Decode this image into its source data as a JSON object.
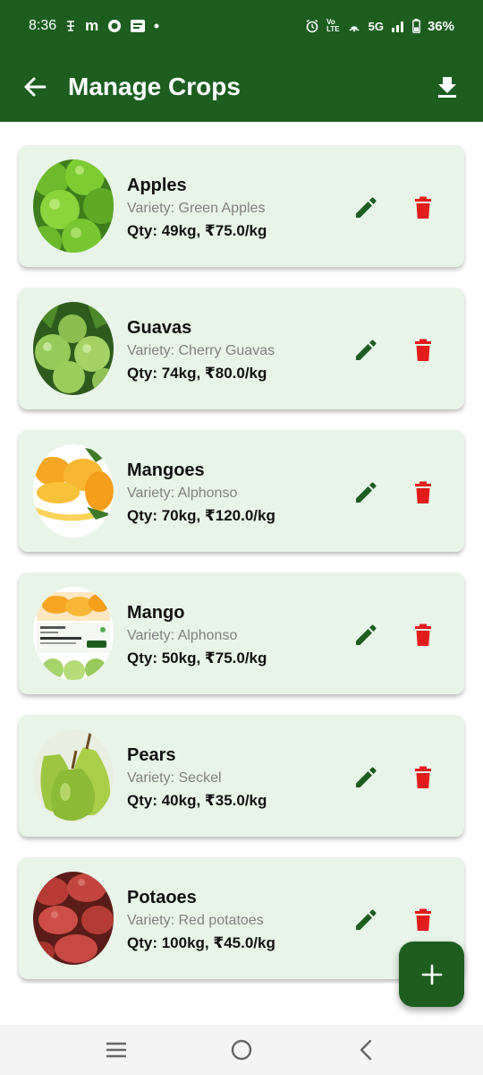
{
  "status_bar": {
    "time": "8:36",
    "left_icons": [
      "signal-stack-icon",
      "m-app-icon",
      "whatsapp-icon",
      "message-icon",
      "dot-icon"
    ],
    "network": "5G",
    "battery": "36%"
  },
  "app_bar": {
    "title": "Manage Crops"
  },
  "crops": [
    {
      "name": "Apples",
      "variety": "Variety: Green Apples",
      "qty": "Qty: 49kg, ₹75.0/kg"
    },
    {
      "name": "Guavas",
      "variety": "Variety: Cherry Guavas",
      "qty": "Qty: 74kg, ₹80.0/kg"
    },
    {
      "name": "Mangoes",
      "variety": "Variety: Alphonso",
      "qty": "Qty: 70kg, ₹120.0/kg"
    },
    {
      "name": "Mango",
      "variety": "Variety: Alphonso",
      "qty": "Qty: 50kg, ₹75.0/kg"
    },
    {
      "name": "Pears",
      "variety": "Variety: Seckel",
      "qty": "Qty: 40kg, ₹35.0/kg"
    },
    {
      "name": "Potaoes",
      "variety": "Variety: Red potatoes",
      "qty": "Qty: 100kg, ₹45.0/kg"
    }
  ],
  "colors": {
    "primary": "#1d5e20",
    "card_bg": "#e8f4e8",
    "delete": "#e31b1b",
    "variety_text": "#808080"
  }
}
